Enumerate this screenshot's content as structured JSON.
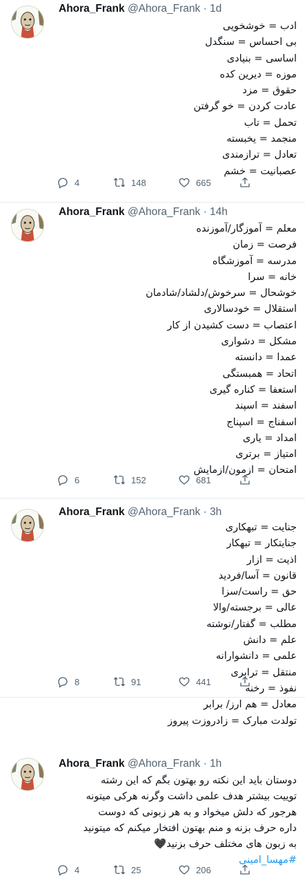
{
  "tweets": [
    {
      "name": "Ahora_Frank",
      "meta": "@Ahora_Frank · 1d",
      "lines": [
        "ادب = خوشخویی",
        "بی احساس = سنگدل",
        "اساسی = بنیادی",
        "موزه = دیرین کده",
        "حقوق = مزد",
        "عادت کردن = خو گرفتن",
        "تحمل = تاب",
        "منجمد = یخبسته",
        "تعادل = ترازمندی",
        "عصبانیت = خشم"
      ],
      "replies": "4",
      "retweets": "148",
      "likes": "665"
    },
    {
      "name": "Ahora_Frank",
      "meta": "@Ahora_Frank · 14h",
      "lines": [
        "معلم = آموزگار/آموزنده",
        "فرصت = زمان",
        "مدرسه = آموزشگاه",
        "خانه = سرا",
        "خوشحال = سرخوش/دلشاد/شادمان",
        "استقلال = خودسالاری",
        "اعتصاب = دست کشیدن از کار",
        "مشکل = دشواری",
        "عمدا = دانسته",
        "اتحاد = همبستگی",
        "استعفا = کناره گیری",
        "اسفند = اسپند",
        "اسفناج = اسپناج",
        "امداد = یاری",
        "امتیاز = برتری",
        "امتحان = ازمون/ازمایش"
      ],
      "replies": "6",
      "retweets": "152",
      "likes": "681"
    },
    {
      "name": "Ahora_Frank",
      "meta": "@Ahora_Frank · 3h",
      "lines": [
        "جنایت = تبهکاری",
        "جنایتکار = تبهکار",
        "اذیت = ازار",
        "قانون = آسا/فردید",
        "حق = راست/سزا",
        "عالی = برجسته/والا",
        "مطلب = گفتار/نوشته",
        "علم = دانش",
        "علمی = دانشوارانه",
        "منتقل = ترابری",
        "نفوذ = رخنه",
        "معادل = هم ارز/ برابر",
        "تولدت مبارک = زادروزت پیروز"
      ],
      "replies": "8",
      "retweets": "91",
      "likes": "441"
    },
    {
      "name": "Ahora_Frank",
      "meta": "@Ahora_Frank · 1h",
      "lines": [
        "دوستان باید این نکته رو بهتون بگم که این رشته",
        "توییت بیشتر هدف علمی داشت وگرنه هرکی میتونه",
        "هرجور که دلش میخواد و به هر زبونی که دوست",
        "داره حرف بزنه و منم بهتون افتخار میکنم که میتونید",
        "به زبون های مختلف حرف بزنید🖤"
      ],
      "hashtag": "#مهسا_امینی",
      "replies": "4",
      "retweets": "25",
      "likes": "206"
    }
  ],
  "icons": {
    "reply": "reply-icon",
    "retweet": "retweet-icon",
    "like": "heart-icon",
    "share": "share-icon",
    "avatar": "avatar-illustration"
  },
  "colors": {
    "text": "#0f1419",
    "secondary": "#536471",
    "link": "#1d9bf0",
    "divider": "#e6ecf0"
  }
}
